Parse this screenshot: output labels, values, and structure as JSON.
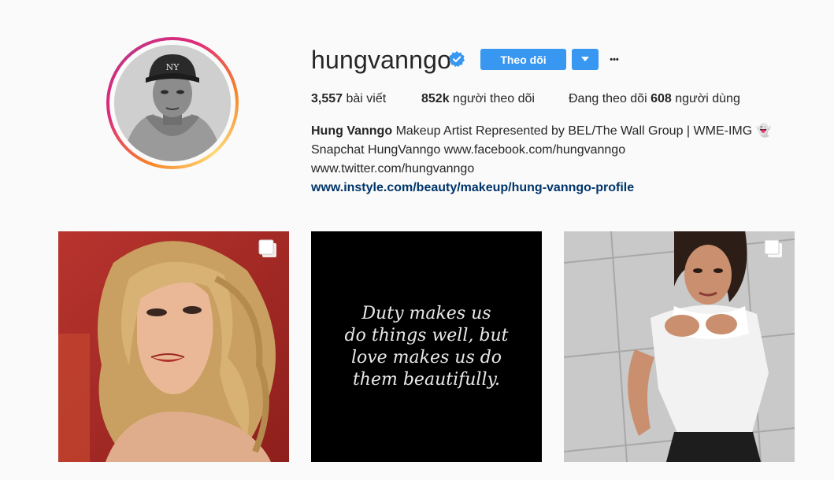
{
  "profile": {
    "username": "hungvanngo",
    "verified": true,
    "follow_label": "Theo dõi",
    "more_label": "•••",
    "accent": "#3897f0"
  },
  "stats": {
    "posts_count": "3,557",
    "posts_label": "bài viết",
    "followers_count": "852k",
    "followers_label": "người theo dõi",
    "following_prefix": "Đang theo dõi",
    "following_count": "608",
    "following_suffix": "người dùng"
  },
  "bio": {
    "name": "Hung Vanngo",
    "line1_rest": "Makeup Artist Represented by BEL/The Wall Group | WME-IMG",
    "line1_emoji": "👻",
    "line2": "Snapchat HungVanngo www.facebook.com/hungvanngo",
    "line3": "www.twitter.com/hungvanngo",
    "link": "www.instyle.com/beauty/makeup/hung-vanngo-profile"
  },
  "posts": [
    {
      "kind": "photo",
      "subject": "blonde woman portrait",
      "multi": true
    },
    {
      "kind": "quote",
      "lines": [
        "Duty makes us",
        "do things well, but",
        "love makes us do",
        "them beautifully."
      ],
      "multi": false
    },
    {
      "kind": "photo",
      "subject": "woman in white top against tiled wall",
      "multi": true
    }
  ]
}
